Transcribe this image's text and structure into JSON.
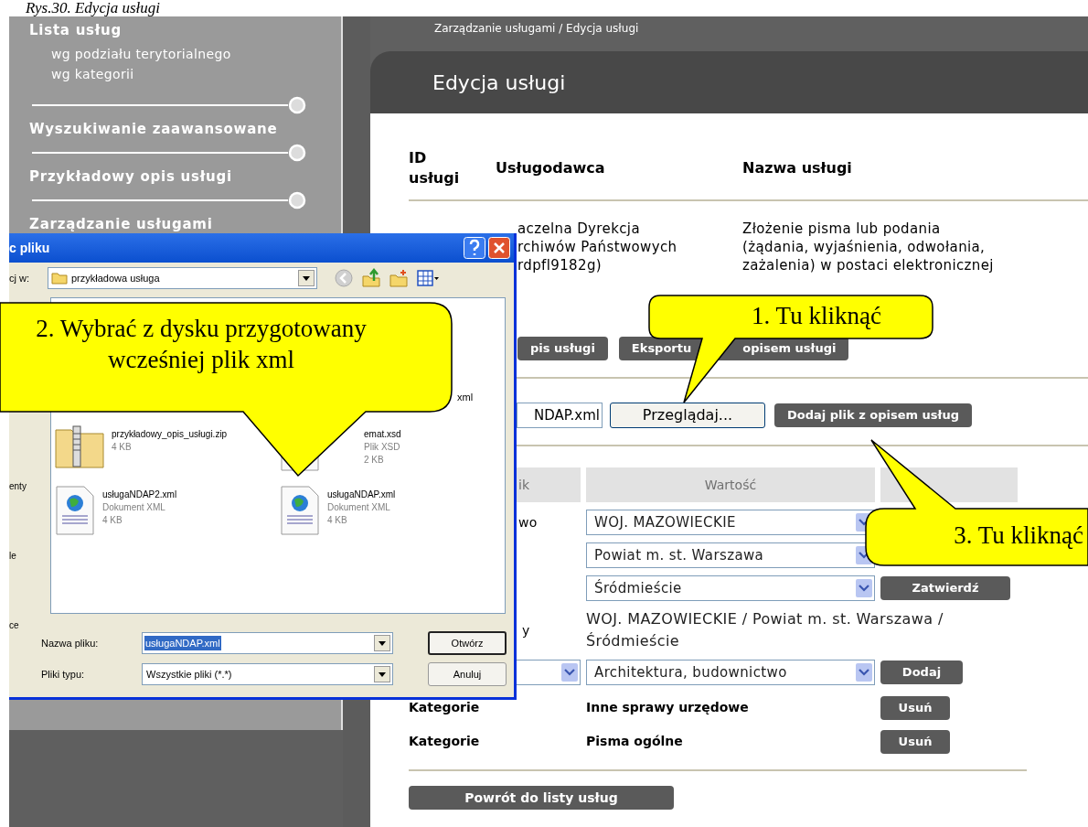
{
  "caption": "Rys.30. Edycja usługi",
  "sidebar": {
    "items": [
      {
        "label": "Lista usług",
        "children": [
          {
            "label": "wg podziału terytorialnego"
          },
          {
            "label": "wg kategorii"
          }
        ]
      },
      {
        "label": "Wyszukiwanie zaawansowane"
      },
      {
        "label": "Przykładowy opis usługi"
      },
      {
        "label": "Zarządzanie usługami"
      }
    ]
  },
  "breadcrumb": "Zarządzanie usługami / Edycja usługi",
  "page_title": "Edycja usługi",
  "service_table": {
    "columns": [
      "ID usługi",
      "Usługodawca",
      "Nazwa usługi"
    ],
    "provider": [
      "aczelna Dyrekcja",
      "rchiwów Państwowych",
      "rdpfl9182g)"
    ],
    "service_name": [
      "Złożenie pisma lub podania",
      "(żądania, wyjaśnienia, odwołania,",
      "zażalenia) w postaci elektronicznej"
    ]
  },
  "description_button": "pis usługi",
  "export_button": {
    "start": "Eksportu",
    "end": "opisem usługi"
  },
  "file_upload": {
    "value": "NDAP.xml",
    "browse_button": "Przeglądaj...",
    "add_button": "Dodaj plik z opisem usług"
  },
  "attributes": {
    "columns": [
      "ik",
      "Wartość"
    ],
    "location": {
      "label": "wo",
      "selects": [
        "WOJ. MAZOWIECKIE",
        "Powiat m. st. Warszawa",
        "Śródmieście"
      ],
      "button": "Zatwierdź"
    },
    "selected_location": {
      "label": "y",
      "value": "WOJ. MAZOWIECKIE / Powiat m. st. Warszawa / Śródmieście"
    },
    "category_add": {
      "value": "Architektura, budownictwo",
      "button": "Dodaj"
    },
    "categories": [
      {
        "label": "Kategorie",
        "value": "Inne sprawy urzędowe",
        "button": "Usuń"
      },
      {
        "label": "Kategorie",
        "value": "Pisma ogólne",
        "button": "Usuń"
      }
    ]
  },
  "back_button": "Powrót do listy usług",
  "file_dialog": {
    "title": "c pliku",
    "look_in_label": "cj w:",
    "folder": "przykładowa usługa",
    "places": [
      "enty",
      "le",
      "ce"
    ],
    "files": [
      {
        "kind": "partial",
        "name": "xml"
      },
      {
        "kind": "zip",
        "name": "przykładowy_opis_usługi.zip",
        "size": "4 KB"
      },
      {
        "kind": "xsd",
        "name": "emat.xsd",
        "type": "Plik XSD",
        "size": "2 KB"
      },
      {
        "kind": "xml",
        "name": "usługaNDAP2.xml",
        "type": "Dokument XML",
        "size": "4 KB"
      },
      {
        "kind": "xml",
        "name": "usługaNDAP.xml",
        "type": "Dokument XML",
        "size": "4 KB"
      }
    ],
    "file_name_label": "Nazwa pliku:",
    "file_name": "usługaNDAP.xml",
    "file_type_label": "Pliki typu:",
    "file_type": "Wszystkie pliki (*.*)",
    "open_button": "Otwórz",
    "cancel_button": "Anuluj"
  },
  "callouts": [
    {
      "text": "1. Tu kliknąć"
    },
    {
      "text": "2. Wybrać z dysku przygotowany wcześniej plik xml"
    },
    {
      "text": "3. Tu kliknąć"
    }
  ]
}
